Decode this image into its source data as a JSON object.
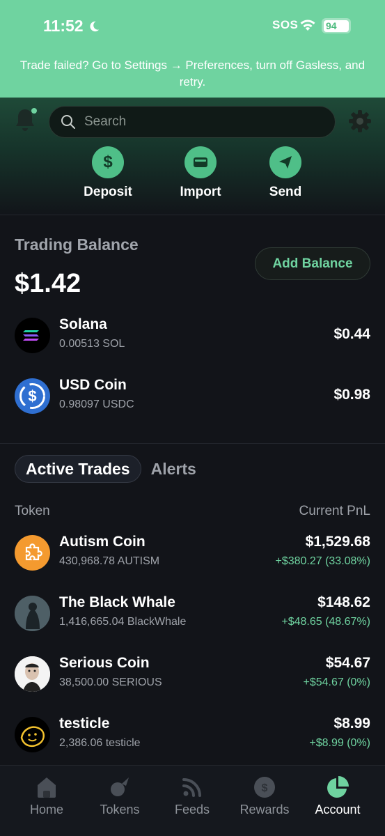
{
  "status_bar": {
    "time": "11:52",
    "sos": "SOS",
    "battery": "94"
  },
  "banner": {
    "text": "Trade failed? Go to Settings → Preferences, turn off Gasless, and retry."
  },
  "search": {
    "placeholder": "Search"
  },
  "quick_actions": [
    {
      "label": "Deposit",
      "icon": "dollar-icon"
    },
    {
      "label": "Import",
      "icon": "wallet-icon"
    },
    {
      "label": "Send",
      "icon": "paper-plane-icon"
    }
  ],
  "balance": {
    "label": "Trading Balance",
    "value": "$1.42",
    "add_button": "Add Balance",
    "assets": [
      {
        "name": "Solana",
        "amount": "0.00513 SOL",
        "value": "$0.44",
        "icon": "solana-icon"
      },
      {
        "name": "USD Coin",
        "amount": "0.98097 USDC",
        "value": "$0.98",
        "icon": "usdc-icon"
      }
    ]
  },
  "tabs": {
    "active": "Active Trades",
    "other": "Alerts"
  },
  "columns": {
    "token": "Token",
    "pnl": "Current PnL"
  },
  "trades": [
    {
      "name": "Autism Coin",
      "amount": "430,968.78 AUTISM",
      "value": "$1,529.68",
      "pnl": "+$380.27 (33.08%)",
      "icon": "puzzle-icon"
    },
    {
      "name": "The Black Whale",
      "amount": "1,416,665.04 BlackWhale",
      "value": "$148.62",
      "pnl": "+$48.65 (48.67%)",
      "icon": "whale-avatar"
    },
    {
      "name": "Serious Coin",
      "amount": "38,500.00 SERIOUS",
      "value": "$54.67",
      "pnl": "+$54.67 (0%)",
      "icon": "face-avatar"
    },
    {
      "name": "testicle",
      "amount": "2,386.06 testicle",
      "value": "$8.99",
      "pnl": "+$8.99 (0%)",
      "icon": "smiley-avatar"
    }
  ],
  "bottom_nav": [
    {
      "label": "Home",
      "icon": "home-icon"
    },
    {
      "label": "Tokens",
      "icon": "comet-icon"
    },
    {
      "label": "Feeds",
      "icon": "feed-icon"
    },
    {
      "label": "Rewards",
      "icon": "coin-icon"
    },
    {
      "label": "Account",
      "icon": "pie-chart-icon",
      "active": true
    }
  ],
  "colors": {
    "accent": "#6fd3a0",
    "background": "#121419"
  }
}
